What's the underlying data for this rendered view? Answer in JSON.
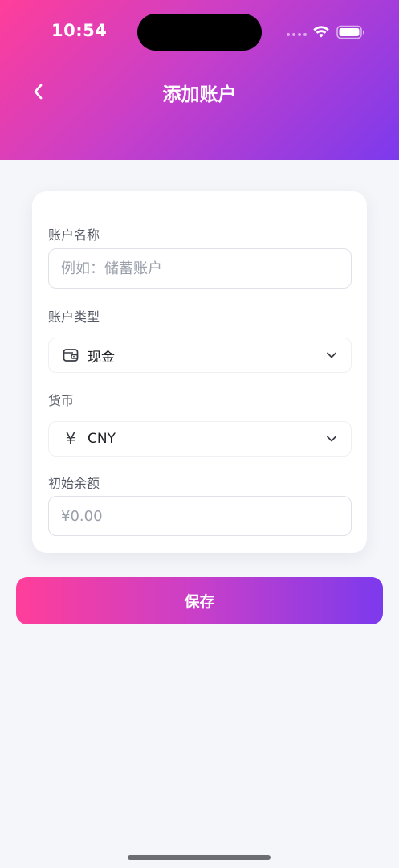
{
  "status_bar": {
    "time": "10:54"
  },
  "header": {
    "title": "添加账户",
    "back_icon": "chevron-left-icon"
  },
  "form": {
    "account_name": {
      "label": "账户名称",
      "placeholder": "例如：储蓄账户",
      "value": ""
    },
    "account_type": {
      "label": "账户类型",
      "icon": "wallet-icon",
      "value": "现金"
    },
    "currency": {
      "label": "货币",
      "icon": "yen-icon",
      "icon_glyph": "¥",
      "value": "CNY"
    },
    "initial_balance": {
      "label": "初始余额",
      "placeholder": "¥0.00",
      "value": ""
    }
  },
  "save_button": {
    "label": "保存"
  },
  "colors": {
    "gradient_start": "#ff3e9a",
    "gradient_mid": "#c83fc9",
    "gradient_end": "#7c3aed",
    "background": "#f5f6fa"
  }
}
